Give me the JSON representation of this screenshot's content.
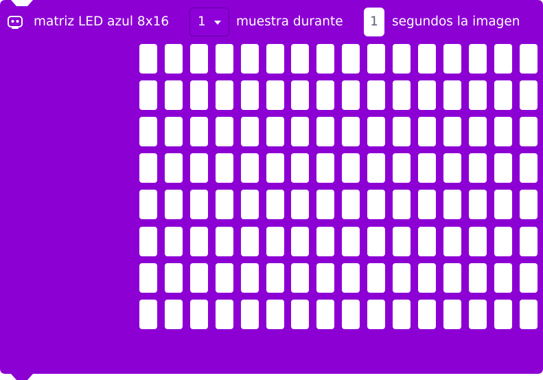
{
  "block": {
    "color": "#8c00d4",
    "title": "matriz LED azul 8x16",
    "icon": "robot-icon",
    "dropdown": {
      "value": "1",
      "icon": "caret-down-icon"
    },
    "label_middle": "muestra durante",
    "seconds_input": "1",
    "label_end": "segundos la imagen"
  },
  "matrix": {
    "rows": 8,
    "cols": 16,
    "led_color": "#ffffff",
    "leds_on": []
  }
}
